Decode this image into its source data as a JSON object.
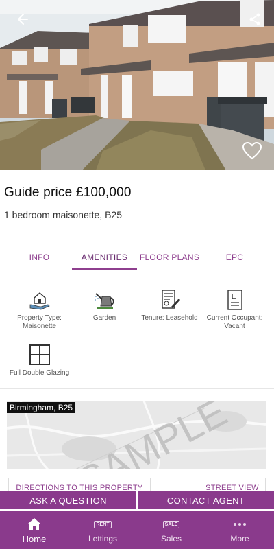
{
  "listing": {
    "price": "Guide price £100,000",
    "subtitle": "1 bedroom maisonette, B25"
  },
  "tabs": [
    {
      "label": "INFO",
      "active": false
    },
    {
      "label": "AMENITIES",
      "active": true
    },
    {
      "label": "FLOOR PLANS",
      "active": false
    },
    {
      "label": "EPC",
      "active": false
    }
  ],
  "amenities": [
    {
      "icon": "house-hand-icon",
      "label": "Property Type: Maisonette"
    },
    {
      "icon": "watering-can-icon",
      "label": "Garden"
    },
    {
      "icon": "contract-pen-icon",
      "label": "Tenure: Leasehold"
    },
    {
      "icon": "document-icon",
      "label": "Current Occupant: Vacant"
    },
    {
      "icon": "window-icon",
      "label": "Full Double Glazing"
    }
  ],
  "map": {
    "location_label": "Birmingham, B25",
    "watermark": "SAMPLE",
    "directions_label": "DIRECTIONS TO THIS PROPERTY",
    "street_view_label": "STREET VIEW"
  },
  "actions": {
    "ask_label": "ASK A QUESTION",
    "contact_label": "CONTACT AGENT"
  },
  "nav": [
    {
      "label": "Home",
      "icon": "home-icon",
      "active": true
    },
    {
      "label": "Lettings",
      "icon": "rent-sign-icon",
      "tag": "RENT",
      "active": false
    },
    {
      "label": "Sales",
      "icon": "sale-sign-icon",
      "tag": "SALE",
      "active": false
    },
    {
      "label": "More",
      "icon": "more-dots-icon",
      "active": false
    }
  ],
  "colors": {
    "accent": "#8a3a8c",
    "tab_text": "#8e3f8e"
  }
}
